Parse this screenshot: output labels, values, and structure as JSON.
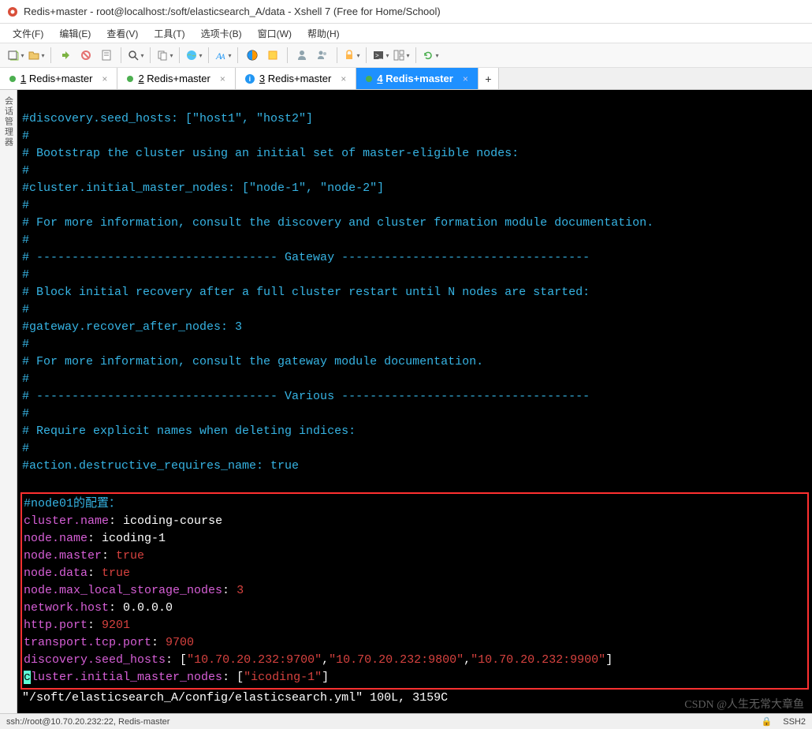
{
  "window": {
    "title": "Redis+master - root@localhost:/soft/elasticsearch_A/data - Xshell 7 (Free for Home/School)"
  },
  "menu": {
    "file": "文件(F)",
    "edit": "编辑(E)",
    "view": "查看(V)",
    "tools": "工具(T)",
    "tabs": "选项卡(B)",
    "window": "窗口(W)",
    "help": "帮助(H)"
  },
  "tabs": {
    "t1_num": "1",
    "t1_label": "Redis+master",
    "t2_num": "2",
    "t2_label": "Redis+master",
    "t3_num": "3",
    "t3_label": "Redis+master",
    "t4_num": "4",
    "t4_label": "Redis+master",
    "add": "+"
  },
  "sidebar": {
    "label": "会话管理器"
  },
  "term": {
    "l01": "#discovery.seed_hosts: [\"host1\", \"host2\"]",
    "l02": "#",
    "l03": "# Bootstrap the cluster using an initial set of master-eligible nodes:",
    "l04": "#",
    "l05": "#cluster.initial_master_nodes: [\"node-1\", \"node-2\"]",
    "l06": "#",
    "l07": "# For more information, consult the discovery and cluster formation module documentation.",
    "l08": "#",
    "l09": "# ---------------------------------- Gateway -----------------------------------",
    "l10": "#",
    "l11": "# Block initial recovery after a full cluster restart until N nodes are started:",
    "l12": "#",
    "l13": "#gateway.recover_after_nodes: 3",
    "l14": "#",
    "l15": "# For more information, consult the gateway module documentation.",
    "l16": "#",
    "l17": "# ---------------------------------- Various -----------------------------------",
    "l18": "#",
    "l19": "# Require explicit names when deleting indices:",
    "l20": "#",
    "l21": "#action.destructive_requires_name: true",
    "l22": "",
    "cfg_header": "#node01的配置：",
    "k_cluster_name": "cluster.name",
    "v_cluster_name": "icoding-course",
    "k_node_name": "node.name",
    "v_node_name": "icoding-1",
    "k_node_master": "node.master",
    "v_node_master": "true",
    "k_node_data": "node.data",
    "v_node_data": "true",
    "k_max_local": "node.max_local_storage_nodes",
    "v_max_local": "3",
    "k_net_host": "network.host",
    "v_net_host": "0.0.0.0",
    "k_http_port": "http.port",
    "v_http_port": "9201",
    "k_tcp_port": "transport.tcp.port",
    "v_tcp_port": "9700",
    "k_seed": "discovery.seed_hosts",
    "seed_lb": "[",
    "seed_q1": "\"10.70.20.232:9700\"",
    "seed_c1": ",",
    "seed_q2": "\"10.70.20.232:9800\"",
    "seed_c2": ",",
    "seed_q3": "\"10.70.20.232:9900\"",
    "seed_rb": "]",
    "k_init_first": "c",
    "k_init_rest": "luster.initial_master_nodes",
    "init_lb": "[",
    "init_q1": "\"icoding-1\"",
    "init_rb": "]",
    "footer": "\"/soft/elasticsearch_A/config/elasticsearch.yml\" 100L, 3159C",
    "colon": ": ",
    "colon2": ":"
  },
  "status": {
    "conn": "ssh://root@10.70.20.232:22, Redis-master",
    "proto": "SSH2"
  },
  "watermark": "CSDN @人生无常大章鱼"
}
